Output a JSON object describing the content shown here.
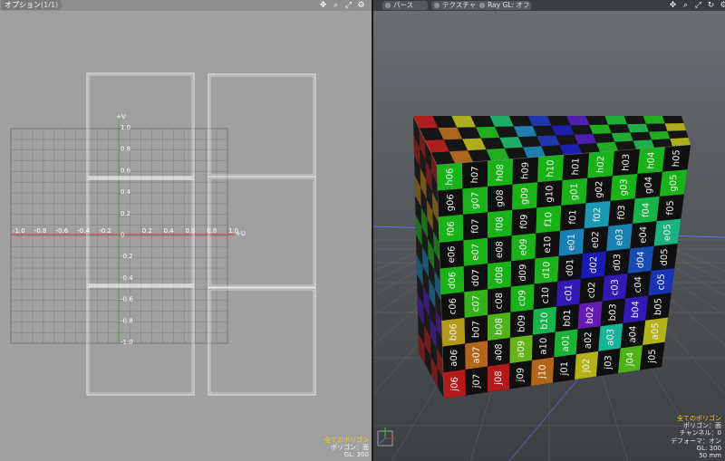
{
  "uv_view": {
    "options_label": "オプション",
    "options_caption": "(1/1)",
    "icons": [
      "move-view-icon",
      "zoom-view-icon",
      "fit-view-icon",
      "settings-icon",
      "expand-icon"
    ],
    "icon_glyphs": [
      "✥",
      "⌕",
      "⤢",
      "⚙",
      "▿"
    ],
    "axis_v_label": "+V",
    "axis_u_label": "+U",
    "v_ticks": [
      "1.0",
      "0.8",
      "0.6",
      "0.4",
      "0.2",
      "0",
      "-0.2",
      "-0.4",
      "-0.6",
      "-0.8",
      "-1.0"
    ],
    "u_ticks": [
      "-1.0",
      "-0.8",
      "-0.6",
      "-0.4",
      "-0.2",
      "0",
      "0.2",
      "0.4",
      "0.6",
      "0.8",
      "1.0"
    ],
    "status": {
      "line1": "全てのポリゴン",
      "line2": "ポリゴン：面",
      "line3": "GL: 300"
    }
  },
  "viewport_3d": {
    "tabs": [
      "パース",
      "テクスチャ",
      "Ray GL: オフ"
    ],
    "icons": [
      "move-view-icon",
      "zoom-view-icon",
      "fit-view-icon",
      "rotate-view-icon",
      "settings-icon",
      "expand-icon"
    ],
    "icon_glyphs": [
      "✥",
      "⌕",
      "⤢",
      "↻",
      "⚙",
      "▿"
    ],
    "status": {
      "line1": "全てのポリゴン",
      "line2": "ポリゴン：面",
      "line3": "チャンネル：0",
      "line4": "デフォーマ：オン",
      "line5": "GL: 300",
      "line6": "50 mm"
    },
    "uv_grid_labels": {
      "rows": [
        "h",
        "g",
        "f",
        "e",
        "d",
        "c",
        "b",
        "a",
        "j"
      ],
      "cols": [
        "06",
        "07",
        "08",
        "09",
        "10",
        "01",
        "02",
        "03",
        "04",
        "05"
      ]
    },
    "colors": {
      "red": "#c0141a",
      "yellow": "#c8b000",
      "green": "#1da01d",
      "teal": "#14a07a",
      "blue": "#1f3fc8",
      "purple": "#5a2aa8",
      "checker_dark": "#111111"
    }
  }
}
